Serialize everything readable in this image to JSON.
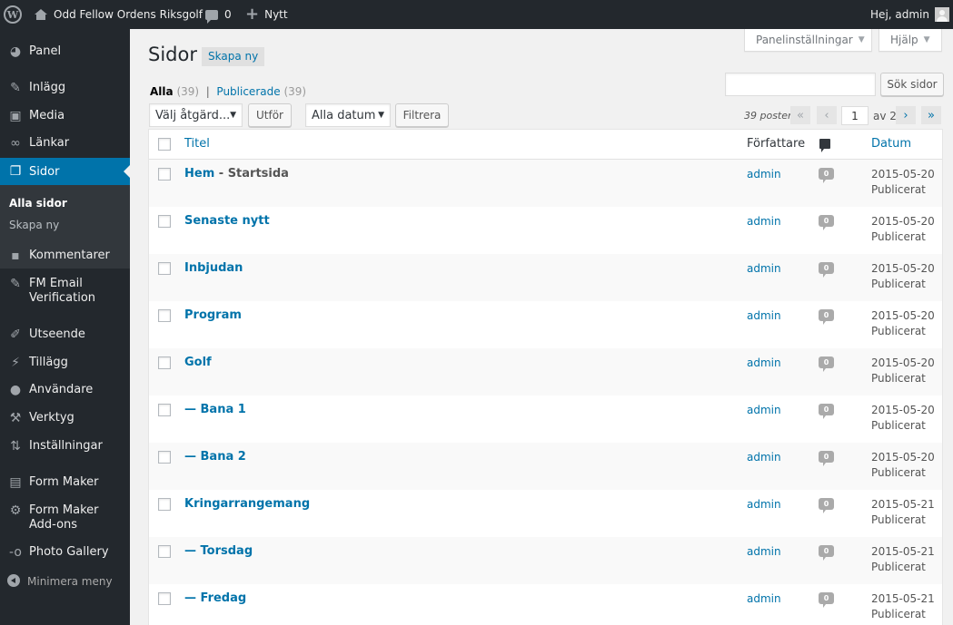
{
  "adminbar": {
    "site_name": "Odd Fellow Ordens Riksgolf",
    "comments_count": "0",
    "new_label": "Nytt",
    "greeting": "Hej, admin"
  },
  "sidebar": {
    "items": [
      {
        "label": "Panel",
        "icon": "dashboard-icon"
      },
      {
        "label": "Inlägg",
        "icon": "pushpin-icon"
      },
      {
        "label": "Media",
        "icon": "media-icon"
      },
      {
        "label": "Länkar",
        "icon": "link-icon"
      },
      {
        "label": "Sidor",
        "icon": "pages-icon",
        "current": true
      },
      {
        "label": "Kommentarer",
        "icon": "comment-icon"
      },
      {
        "label": "FM Email Verification",
        "icon": "pushpin-icon"
      },
      {
        "label": "Utseende",
        "icon": "paintbrush-icon"
      },
      {
        "label": "Tillägg",
        "icon": "plugin-icon"
      },
      {
        "label": "Användare",
        "icon": "user-icon"
      },
      {
        "label": "Verktyg",
        "icon": "wrench-icon"
      },
      {
        "label": "Inställningar",
        "icon": "settings-icon"
      },
      {
        "label": "Form Maker",
        "icon": "form-icon"
      },
      {
        "label": "Form Maker Add-ons",
        "icon": "gear-icon"
      },
      {
        "label": "Photo Gallery",
        "icon": "gallery-icon"
      }
    ],
    "submenu": [
      "Alla sidor",
      "Skapa ny"
    ],
    "collapse_label": "Minimera meny"
  },
  "header": {
    "screen_options": "Panelinställningar",
    "help": "Hjälp",
    "title": "Sidor",
    "add_new": "Skapa ny"
  },
  "filters": {
    "all_label": "Alla",
    "all_count": "(39)",
    "published_label": "Publicerade",
    "published_count": "(39)",
    "separator": "|",
    "search_value": "",
    "search_button": "Sök sidor",
    "bulk_action": "Välj åtgärd...",
    "apply_button": "Utför",
    "date_filter": "Alla datum",
    "filter_button": "Filtrera"
  },
  "pagination": {
    "displaying": "39 poster",
    "first": "«",
    "prev": "‹",
    "current_page": "1",
    "of_total": "av 2",
    "next": "›",
    "last": "»"
  },
  "table": {
    "columns": {
      "title": "Titel",
      "author": "Författare",
      "date": "Datum"
    },
    "rows": [
      {
        "title": "Hem",
        "state": " - Startsida",
        "author": "admin",
        "comments": "0",
        "date": "2015-05-20",
        "status": "Publicerat"
      },
      {
        "title": "Senaste nytt",
        "state": "",
        "author": "admin",
        "comments": "0",
        "date": "2015-05-20",
        "status": "Publicerat"
      },
      {
        "title": "Inbjudan",
        "state": "",
        "author": "admin",
        "comments": "0",
        "date": "2015-05-20",
        "status": "Publicerat"
      },
      {
        "title": "Program",
        "state": "",
        "author": "admin",
        "comments": "0",
        "date": "2015-05-20",
        "status": "Publicerat"
      },
      {
        "title": "Golf",
        "state": "",
        "author": "admin",
        "comments": "0",
        "date": "2015-05-20",
        "status": "Publicerat"
      },
      {
        "title": "— Bana 1",
        "state": "",
        "author": "admin",
        "comments": "0",
        "date": "2015-05-20",
        "status": "Publicerat"
      },
      {
        "title": "— Bana 2",
        "state": "",
        "author": "admin",
        "comments": "0",
        "date": "2015-05-20",
        "status": "Publicerat"
      },
      {
        "title": "Kringarrangemang",
        "state": "",
        "author": "admin",
        "comments": "0",
        "date": "2015-05-21",
        "status": "Publicerat"
      },
      {
        "title": "— Torsdag",
        "state": "",
        "author": "admin",
        "comments": "0",
        "date": "2015-05-21",
        "status": "Publicerat"
      },
      {
        "title": "— Fredag",
        "state": "",
        "author": "admin",
        "comments": "0",
        "date": "2015-05-21",
        "status": "Publicerat"
      }
    ]
  },
  "colors": {
    "adminbar_bg": "#23282d",
    "accent": "#0073aa",
    "page_bg": "#f1f1f1"
  }
}
